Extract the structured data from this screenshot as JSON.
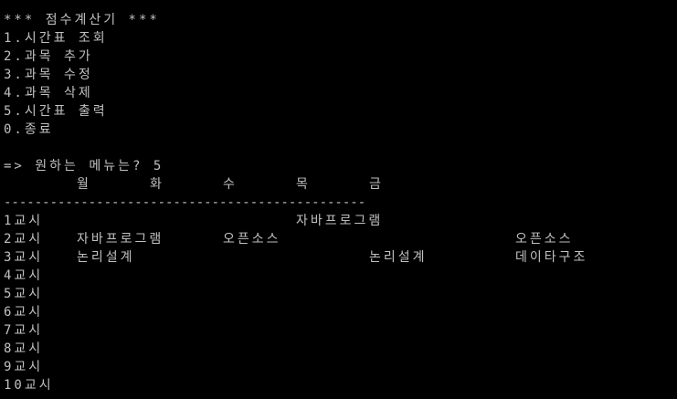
{
  "window": {
    "background": "#000000",
    "text_color": "#c0c0c0"
  },
  "menu": {
    "title": "*** 점수계산기 ***",
    "items": [
      "1.시간표 조회",
      "2.과목 추가",
      "3.과목 수정",
      "4.과목 삭제",
      "5.시간표 출력",
      "0.종료"
    ],
    "prompt": "=> 원하는 메뉴는? 5"
  },
  "timetable": {
    "days": [
      "월",
      "화",
      "수",
      "목",
      "금"
    ],
    "divider": "-----------------------------------------------",
    "rows": [
      {
        "period": "1교시",
        "cells": [
          "",
          "",
          "",
          "자바프로그램",
          "",
          ""
        ]
      },
      {
        "period": "2교시",
        "cells": [
          "자바프로그램",
          "오픈소스",
          "",
          "",
          "",
          "오픈소스"
        ]
      },
      {
        "period": "3교시",
        "cells": [
          "논리설계",
          "",
          "",
          "논리설계",
          "",
          "데이타구조"
        ]
      },
      {
        "period": "4교시",
        "cells": [
          "",
          "",
          "",
          "",
          "",
          ""
        ]
      },
      {
        "period": "5교시",
        "cells": [
          "",
          "",
          "",
          "",
          "",
          ""
        ]
      },
      {
        "period": "6교시",
        "cells": [
          "",
          "",
          "",
          "",
          "",
          ""
        ]
      },
      {
        "period": "7교시",
        "cells": [
          "",
          "",
          "",
          "",
          "",
          ""
        ]
      },
      {
        "period": "8교시",
        "cells": [
          "",
          "",
          "",
          "",
          "",
          ""
        ]
      },
      {
        "period": "9교시",
        "cells": [
          "",
          "",
          "",
          "",
          "",
          ""
        ]
      },
      {
        "period": "10교시",
        "cells": [
          "",
          "",
          "",
          "",
          "",
          ""
        ]
      }
    ]
  }
}
